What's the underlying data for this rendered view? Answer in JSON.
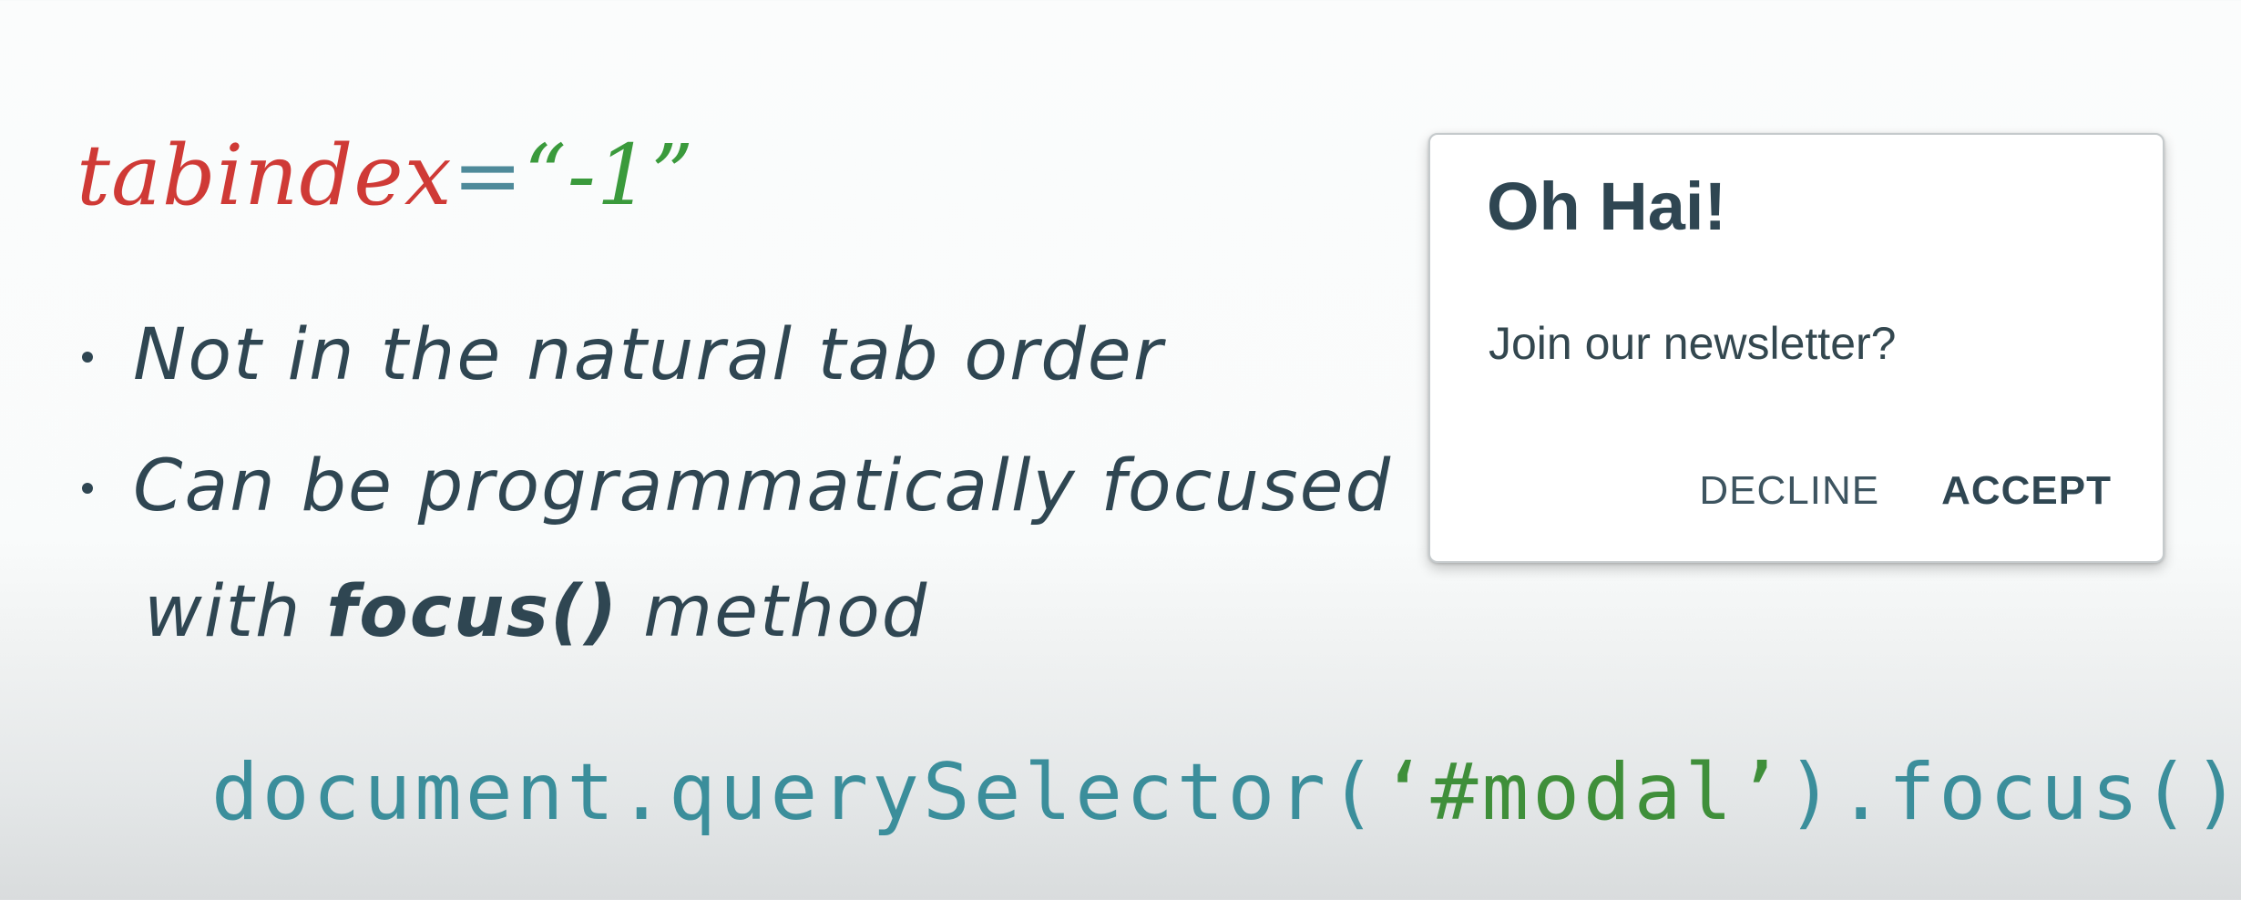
{
  "slide": {
    "heading": {
      "attribute": "tabindex",
      "equals": "=",
      "value": "“-1”"
    },
    "bullets": [
      {
        "line1": "Not in the natural tab order"
      },
      {
        "line1": "Can be programmatically focused",
        "line2_prefix": "with ",
        "line2_bold": "focus()",
        "line2_suffix": " method"
      }
    ],
    "code": {
      "prefix": "document.querySelector(",
      "string": "‘#modal’",
      "suffix": ").focus()"
    }
  },
  "modal": {
    "title": "Oh Hai!",
    "body": "Join our newsletter?",
    "decline_label": "DECLINE",
    "accept_label": "ACCEPT"
  },
  "colors": {
    "attribute": "#cf3a36",
    "equals": "#4e8a9a",
    "value": "#3a9a3c",
    "text": "#2f4652",
    "code": "#3b8e9b",
    "code_string": "#3f8f3a"
  }
}
